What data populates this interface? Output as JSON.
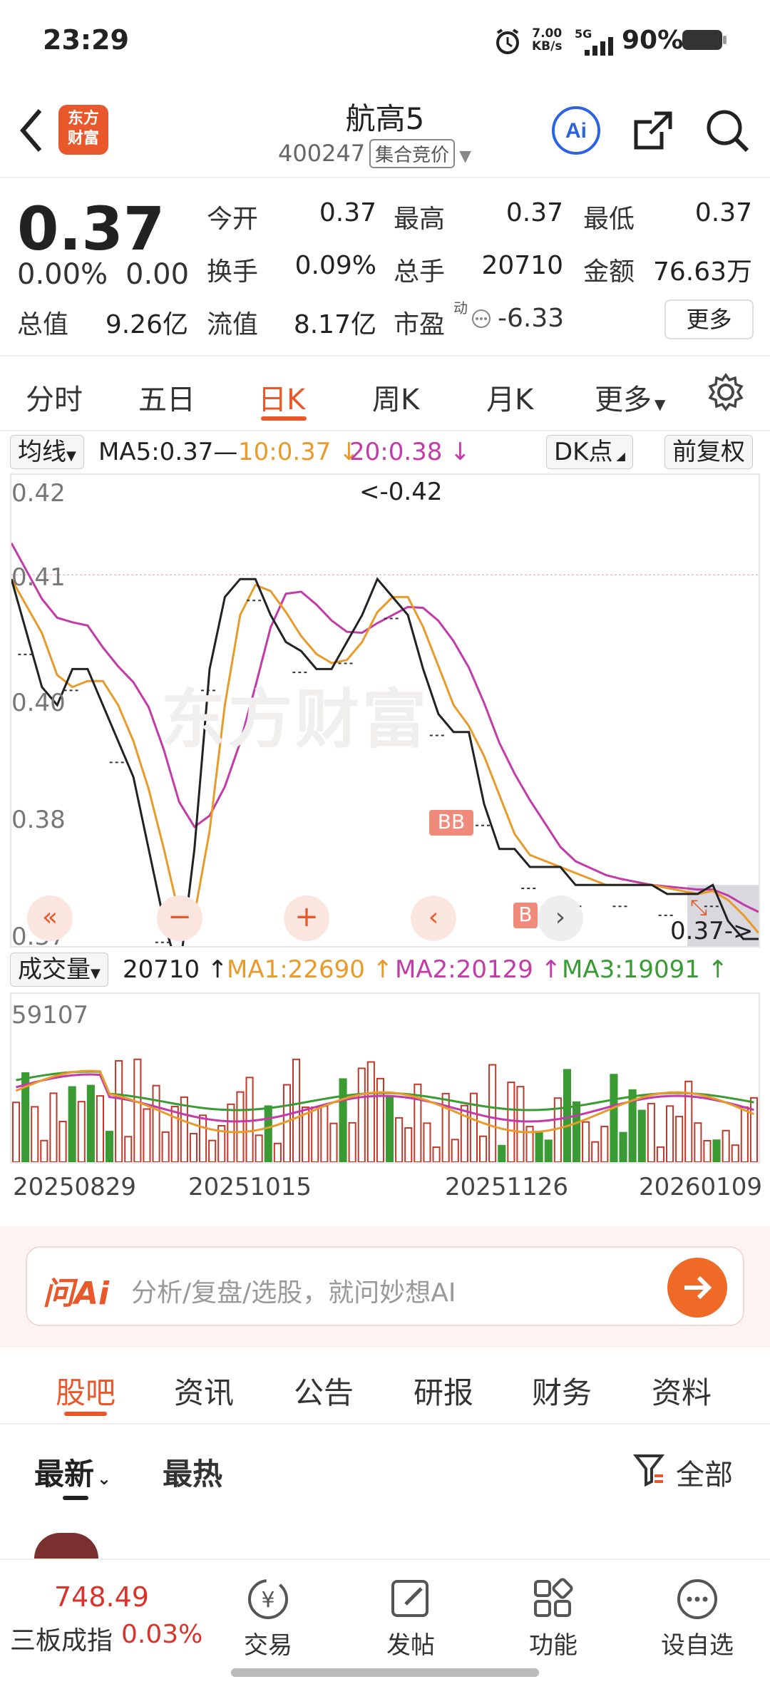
{
  "status": {
    "time": "23:29",
    "net_speed_top": "7.00",
    "net_speed_bottom": "KB/s",
    "network": "5G",
    "battery": "90%"
  },
  "header": {
    "logo_top": "东方",
    "logo_bottom": "财富",
    "title": "航高5",
    "code": "400247",
    "code_tag": "集合竞价"
  },
  "quote": {
    "price": "0.37",
    "change_pct": "0.00%",
    "change": "0.00",
    "open_label": "今开",
    "open": "0.37",
    "high_label": "最高",
    "high": "0.37",
    "low_label": "最低",
    "low": "0.37",
    "turnover_label": "换手",
    "turnover": "0.09%",
    "volume_label": "总手",
    "volume": "20710",
    "amount_label": "金额",
    "amount": "76.63万",
    "mktcap_label": "总值",
    "mktcap": "9.26亿",
    "float_label": "流值",
    "float_cap": "8.17亿",
    "pe_label": "市盈",
    "pe_sup": "动",
    "pe": "-6.33",
    "more": "更多"
  },
  "tabs": [
    "分时",
    "五日",
    "日K",
    "周K",
    "月K",
    "更多"
  ],
  "chart": {
    "ma_select": "均线",
    "ma5": "MA5:0.37—",
    "ma10": "10:0.37 ↓",
    "ma20": "20:0.38 ↓",
    "dk": "DK点",
    "adjust": "前复权",
    "y_labels": [
      "0.42",
      "0.41",
      "0.40",
      "0.38",
      "0.37"
    ],
    "max_note": "<-0.42",
    "last_note": "0.37->",
    "watermark": "东方财富",
    "marker_b": "B",
    "marker_bb": "BB"
  },
  "volume": {
    "select": "成交量",
    "current": "20710 ↑",
    "ma1": "MA1:22690 ↑",
    "ma2": "MA2:20129 ↑",
    "ma3": "MA3:19091 ↑",
    "max": "59107"
  },
  "dates": [
    "20250829",
    "20251015",
    "20251126",
    "20260109"
  ],
  "chart_data": {
    "type": "line",
    "x": [
      "20250829",
      "20251015",
      "20251126",
      "20260109"
    ],
    "close_series": [
      0.41,
      0.404,
      0.398,
      0.396,
      0.4,
      0.4,
      0.396,
      0.392,
      0.388,
      0.38,
      0.372,
      0.366,
      0.38,
      0.4,
      0.408,
      0.41,
      0.41,
      0.406,
      0.403,
      0.402,
      0.4,
      0.4,
      0.403,
      0.406,
      0.41,
      0.408,
      0.406,
      0.4,
      0.395,
      0.393,
      0.393,
      0.385,
      0.38,
      0.38,
      0.378,
      0.378,
      0.378,
      0.376,
      0.376,
      0.376,
      0.376,
      0.376,
      0.376,
      0.375,
      0.375,
      0.375,
      0.376,
      0.372,
      0.37,
      0.37
    ],
    "ylim": [
      0.37,
      0.42
    ],
    "volume_ylim": [
      0,
      59107
    ]
  },
  "ai": {
    "logo": "问Ai",
    "placeholder": "分析/复盘/选股，就问妙想AI"
  },
  "subtabs": [
    "股吧",
    "资讯",
    "公告",
    "研报",
    "财务",
    "资料"
  ],
  "filter": {
    "latest": "最新",
    "hot": "最热",
    "all": "全部"
  },
  "bottom": {
    "index_value": "748.49",
    "index_name": "三板成指",
    "index_pct": "0.03%",
    "trade": "交易",
    "post": "发帖",
    "func": "功能",
    "watch": "设自选"
  }
}
